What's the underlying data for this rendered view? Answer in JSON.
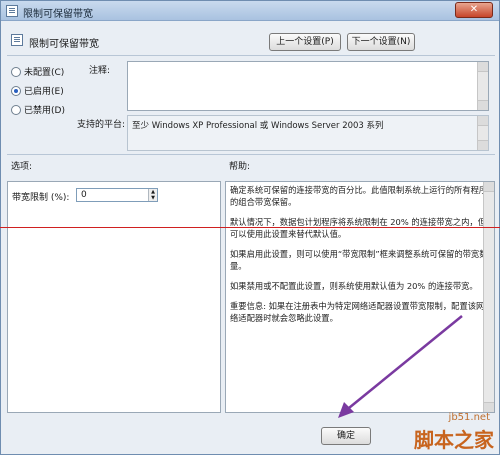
{
  "window": {
    "title": "限制可保留带宽",
    "close_glyph": "✕"
  },
  "header": {
    "title": "限制可保留带宽",
    "prev_button": "上一个设置(P)",
    "next_button": "下一个设置(N)"
  },
  "state_options": [
    {
      "label": "未配置(C)",
      "selected": false
    },
    {
      "label": "已启用(E)",
      "selected": true
    },
    {
      "label": "已禁用(D)",
      "selected": false
    }
  ],
  "comment": {
    "label": "注释:",
    "value": ""
  },
  "platform": {
    "label": "支持的平台:",
    "value": "至少 Windows XP Professional 或 Windows Server 2003 系列"
  },
  "options": {
    "label": "选项:",
    "bandwidth_label": "带宽限制 (%):",
    "bandwidth_value": "0"
  },
  "help": {
    "label": "帮助:",
    "paragraphs": [
      "确定系统可保留的连接带宽的百分比。此值限制系统上运行的所有程序的组合带宽保留。",
      "默认情况下，数据包计划程序将系统限制在 20% 的连接带宽之内，但可以使用此设置来替代默认值。",
      "如果启用此设置，则可以使用“带宽限制”框来调整系统可保留的带宽数量。",
      "如果禁用或不配置此设置，则系统使用默认值为 20% 的连接带宽。",
      "重要信息: 如果在注册表中为特定网络适配器设置带宽限制，配置该网络适配器时就会忽略此设置。"
    ]
  },
  "footer": {
    "ok_button": "确定"
  },
  "watermark": {
    "site": "jb51.net",
    "brand": "脚本之家"
  },
  "colors": {
    "annotation_line": "#d02020",
    "annotation_arrow": "#7a3aa0"
  }
}
